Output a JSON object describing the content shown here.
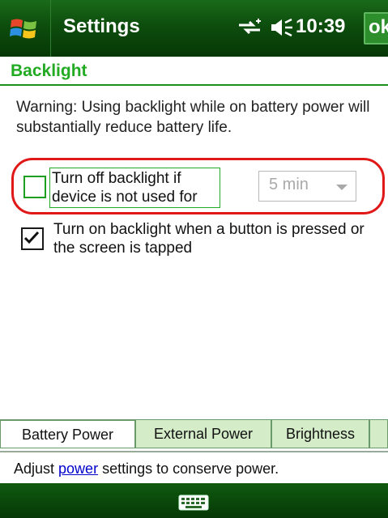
{
  "titlebar": {
    "title": "Settings",
    "time": "10:39",
    "ok_label": "ok"
  },
  "page": {
    "heading": "Backlight"
  },
  "warning": "Warning: Using backlight while on battery power will substantially reduce battery life.",
  "option1": {
    "label": "Turn off backlight if device is not used for",
    "checked": false,
    "dropdown_value": "5 min"
  },
  "option2": {
    "label": "Turn on backlight when a button is pressed or the screen is tapped",
    "checked": true
  },
  "tabs": [
    {
      "label": "Battery Power"
    },
    {
      "label": "External Power"
    },
    {
      "label": "Brightness"
    }
  ],
  "status": {
    "prefix": "Adjust ",
    "link": "power",
    "suffix": " settings to conserve power."
  },
  "icons": {
    "start": "windows-logo-icon",
    "connectivity": "connectivity-icon",
    "volume": "volume-icon",
    "keyboard": "keyboard-icon"
  },
  "colors": {
    "titlebar": "#0d4d0d",
    "heading": "#22aa22",
    "highlight": "#e01818",
    "tab_inactive": "#d4ecc8"
  }
}
